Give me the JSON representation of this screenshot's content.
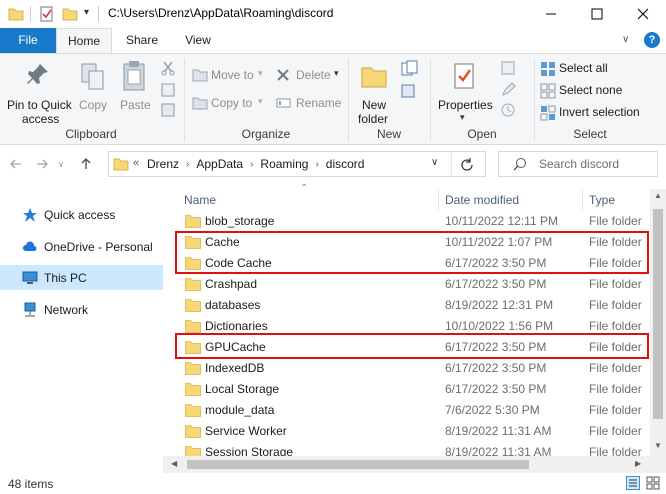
{
  "window": {
    "path": "C:\\Users\\Drenz\\AppData\\Roaming\\discord"
  },
  "tabs": {
    "file": "File",
    "home": "Home",
    "share": "Share",
    "view": "View"
  },
  "ribbon": {
    "clipboard": {
      "pin_line1": "Pin to Quick",
      "pin_line2": "access",
      "copy": "Copy",
      "paste": "Paste",
      "group": "Clipboard"
    },
    "organize": {
      "move_to": "Move to",
      "copy_to": "Copy to",
      "delete": "Delete",
      "rename": "Rename",
      "group": "Organize"
    },
    "new": {
      "folder_line1": "New",
      "folder_line2": "folder",
      "group": "New"
    },
    "open": {
      "properties": "Properties",
      "group": "Open"
    },
    "select": {
      "select_all": "Select all",
      "select_none": "Select none",
      "invert": "Invert selection",
      "group": "Select"
    }
  },
  "address": {
    "crumbs": [
      "Drenz",
      "AppData",
      "Roaming",
      "discord"
    ],
    "overflow": "«",
    "search_placeholder": "Search discord"
  },
  "nav": {
    "quick_access": "Quick access",
    "onedrive": "OneDrive - Personal",
    "this_pc": "This PC",
    "network": "Network"
  },
  "columns": {
    "name": "Name",
    "date": "Date modified",
    "type": "Type"
  },
  "files": [
    {
      "name": "blob_storage",
      "date": "10/11/2022 12:11 PM",
      "type": "File folder"
    },
    {
      "name": "Cache",
      "date": "10/11/2022 1:07 PM",
      "type": "File folder"
    },
    {
      "name": "Code Cache",
      "date": "6/17/2022 3:50 PM",
      "type": "File folder"
    },
    {
      "name": "Crashpad",
      "date": "6/17/2022 3:50 PM",
      "type": "File folder"
    },
    {
      "name": "databases",
      "date": "8/19/2022 12:31 PM",
      "type": "File folder"
    },
    {
      "name": "Dictionaries",
      "date": "10/10/2022 1:56 PM",
      "type": "File folder"
    },
    {
      "name": "GPUCache",
      "date": "6/17/2022 3:50 PM",
      "type": "File folder"
    },
    {
      "name": "IndexedDB",
      "date": "6/17/2022 3:50 PM",
      "type": "File folder"
    },
    {
      "name": "Local Storage",
      "date": "6/17/2022 3:50 PM",
      "type": "File folder"
    },
    {
      "name": "module_data",
      "date": "7/6/2022 5:30 PM",
      "type": "File folder"
    },
    {
      "name": "Service Worker",
      "date": "8/19/2022 11:31 AM",
      "type": "File folder"
    },
    {
      "name": "Session Storage",
      "date": "8/19/2022 11:31 AM",
      "type": "File folder"
    }
  ],
  "status": {
    "count": "48 items"
  },
  "colors": {
    "accent": "#1979ca",
    "folder": "#f8d775",
    "highlight": "#e01010",
    "selected": "#cce8ff"
  }
}
